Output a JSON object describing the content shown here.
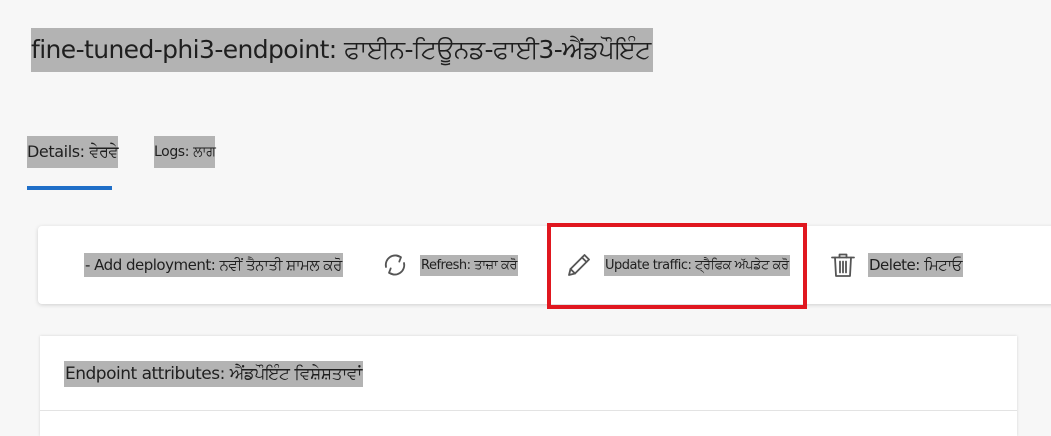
{
  "page": {
    "title": "fine-tuned-phi3-endpoint: ਫਾਈਨ-ਟਿਊਨਡ-ਫਾਈ3-ਐਂਡਪੌਇੰਟ"
  },
  "tabs": [
    {
      "label": "Details: ਵੇਰਵੇ",
      "selected": true
    },
    {
      "label": "Logs: ਲਾਗ",
      "selected": false
    }
  ],
  "toolbar": {
    "add_deployment": "- Add deployment: ਨਵੀਂ ਤੈਨਾਤੀ ਸ਼ਾਮਲ ਕਰੋ",
    "refresh": "Refresh: ਤਾਜ਼ਾ ਕਰੋ",
    "update_traffic": "Update traffic: ਟ੍ਰੈਫਿਕ ਅੱਪਡੇਟ ਕਰੋ",
    "delete": "Delete: ਮਿਟਾਓ"
  },
  "icons": {
    "refresh": "refresh-icon",
    "update_traffic": "pencil-icon",
    "delete": "trash-icon"
  },
  "panel": {
    "title": "Endpoint attributes: ਐਂਡਪੌਇੰਟ ਵਿਸ਼ੇਸ਼ਤਾਵਾਂ"
  },
  "colors": {
    "accent": "#1f6fc8",
    "highlight_box": "#e0171f",
    "text_highlight": "#b3b3b3"
  }
}
